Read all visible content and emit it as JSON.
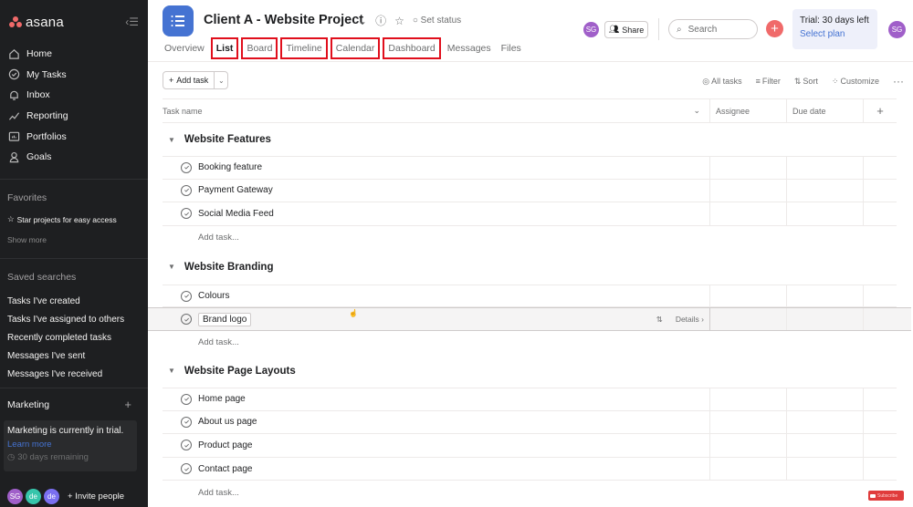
{
  "sidebar": {
    "brand": "asana",
    "nav": [
      {
        "label": "Home",
        "icon": "home-icon"
      },
      {
        "label": "My Tasks",
        "icon": "check-circle-icon"
      },
      {
        "label": "Inbox",
        "icon": "bell-icon"
      },
      {
        "label": "Reporting",
        "icon": "chart-line-icon"
      },
      {
        "label": "Portfolios",
        "icon": "folder-icon"
      },
      {
        "label": "Goals",
        "icon": "person-icon"
      }
    ],
    "favorites": {
      "title": "Favorites",
      "hint": "Star projects for easy access",
      "show_more": "Show more"
    },
    "saved_searches": {
      "title": "Saved searches",
      "items": [
        "Tasks I've created",
        "Tasks I've assigned to others",
        "Recently completed tasks",
        "Messages I've sent",
        "Messages I've received"
      ]
    },
    "team": {
      "name": "Marketing",
      "add": "+",
      "trial_text": "Marketing is currently in trial.",
      "learn_more": "Learn more",
      "remaining": "30 days remaining"
    },
    "members": [
      {
        "initials": "SG",
        "color": "#a05fc9"
      },
      {
        "initials": "de",
        "color": "#37c5ab"
      },
      {
        "initials": "de",
        "color": "#7a6ff0"
      }
    ],
    "invite": "+ Invite people"
  },
  "header": {
    "project_title": "Client A - Website Project",
    "set_status": "Set status",
    "tabs": [
      {
        "label": "Overview",
        "active": false,
        "highlighted": false
      },
      {
        "label": "List",
        "active": true,
        "highlighted": true
      },
      {
        "label": "Board",
        "active": false,
        "highlighted": true
      },
      {
        "label": "Timeline",
        "active": false,
        "highlighted": true
      },
      {
        "label": "Calendar",
        "active": false,
        "highlighted": true
      },
      {
        "label": "Dashboard",
        "active": false,
        "highlighted": true
      },
      {
        "label": "Messages",
        "active": false,
        "highlighted": false
      },
      {
        "label": "Files",
        "active": false,
        "highlighted": false
      }
    ],
    "member_avatar": "SG",
    "share": "Share",
    "search_placeholder": "Search",
    "trial": "Trial: 30 days left",
    "select_plan": "Select plan",
    "user_avatar": "SG",
    "accent": "#4573d2",
    "highlight_color": "#e00f1c"
  },
  "toolbar": {
    "add_task": "Add task",
    "all_tasks": "All tasks",
    "filter": "Filter",
    "sort": "Sort",
    "customize": "Customize",
    "more": "···"
  },
  "table": {
    "columns": [
      "Task name",
      "Assignee",
      "Due date"
    ],
    "add_column": "+",
    "add_task_placeholder": "Add task...",
    "sections": [
      {
        "name": "Website Features",
        "tasks": [
          "Booking feature",
          "Payment Gateway",
          "Social Media Feed"
        ]
      },
      {
        "name": "Website Branding",
        "tasks": [
          "Colours",
          "Brand logo"
        ]
      },
      {
        "name": "Website Page Layouts",
        "tasks": [
          "Home page",
          "About us page",
          "Product page",
          "Contact page"
        ]
      }
    ],
    "details": "Details ›"
  },
  "overlay": {
    "subscribe": "Subscribe"
  }
}
